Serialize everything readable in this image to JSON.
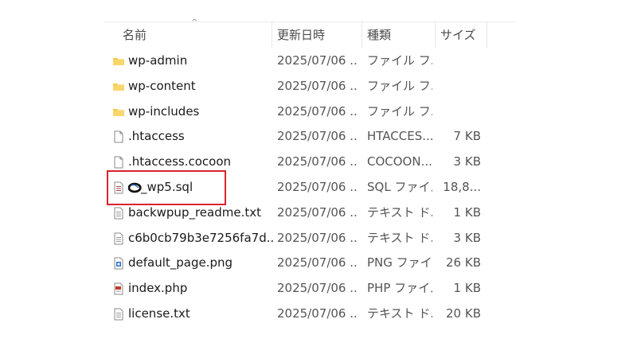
{
  "columns": {
    "name": "名前",
    "date": "更新日時",
    "type": "種類",
    "size": "サイズ",
    "sort_indicator": "^"
  },
  "rows": [
    {
      "name": "wp-admin",
      "date": "2025/07/06 ...",
      "type": "ファイル フ...",
      "size": "",
      "icon": "folder-icon"
    },
    {
      "name": "wp-content",
      "date": "2025/07/06 ...",
      "type": "ファイル フ...",
      "size": "",
      "icon": "folder-icon"
    },
    {
      "name": "wp-includes",
      "date": "2025/07/06 ...",
      "type": "ファイル フ...",
      "size": "",
      "icon": "folder-icon"
    },
    {
      "name": ".htaccess",
      "date": "2025/07/06 ...",
      "type": "HTACCES...",
      "size": "7 KB",
      "icon": "blank-file-icon"
    },
    {
      "name": ".htaccess.cocoon",
      "date": "2025/07/06 ...",
      "type": "COCOON...",
      "size": "3 KB",
      "icon": "blank-file-icon"
    },
    {
      "name": "_wp5.sql",
      "date": "2025/07/06 ...",
      "type": "SQL ファイル",
      "size": "18,8...",
      "icon": "sql-file-icon"
    },
    {
      "name": "backwpup_readme.txt",
      "date": "2025/07/06 ...",
      "type": "テキスト ド...",
      "size": "1 KB",
      "icon": "text-file-icon"
    },
    {
      "name": "c6b0cb79b3e7256fa7d...",
      "date": "2025/07/06 ...",
      "type": "テキスト ド...",
      "size": "3 KB",
      "icon": "text-file-icon"
    },
    {
      "name": "default_page.png",
      "date": "2025/07/06 ...",
      "type": "PNG ファイ...",
      "size": "26 KB",
      "icon": "image-file-icon"
    },
    {
      "name": "index.php",
      "date": "2025/07/06 ...",
      "type": "PHP ファイル",
      "size": "1 KB",
      "icon": "php-file-icon"
    },
    {
      "name": "license.txt",
      "date": "2025/07/06 ...",
      "type": "テキスト ド...",
      "size": "20 KB",
      "icon": "text-file-icon"
    }
  ],
  "colors": {
    "folder": "#f8c64a",
    "highlight": "#d8242c",
    "image_icon": "#2e6fd6",
    "php_icon": "#c0392b"
  }
}
